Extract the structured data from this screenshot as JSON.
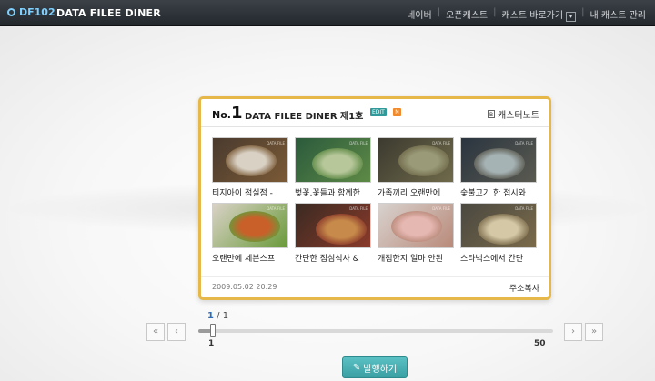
{
  "topbar": {
    "logo_text": "DF102",
    "app_title": "DATA FILEE DINER",
    "nav": [
      "네이버",
      "오픈캐스트",
      "캐스트 바로가기",
      "내 캐스트 관리"
    ]
  },
  "card": {
    "no_prefix": "No.",
    "no_number": "1",
    "title": "DATA FILEE DINER 제1호",
    "edit_badge": "EDIT",
    "n_badge": "N",
    "note_icon": "B",
    "note_link": "캐스터노트",
    "date": "2009.05.02 20:29",
    "copy_link": "주소복사",
    "items": [
      {
        "caption": "티지아이 점실점 -",
        "colors": [
          "#4a3a2e",
          "#d9d1c4",
          "#7a5a36"
        ],
        "stamp": "DATA FILE"
      },
      {
        "caption": "벚꽃,꽃들과 함께한",
        "colors": [
          "#2b5a3c",
          "#b7c79a",
          "#5e8a46"
        ],
        "stamp": "DATA FILE"
      },
      {
        "caption": "가족끼리 오랜만에",
        "colors": [
          "#3c3a30",
          "#9a9a78",
          "#6f6a4a"
        ],
        "stamp": "DATA FILE"
      },
      {
        "caption": "숯불고기 한 접시와",
        "colors": [
          "#2a3540",
          "#a6b3b5",
          "#5a5a50"
        ],
        "stamp": "DATA FILE"
      },
      {
        "caption": "오랜만에 세븐스프",
        "colors": [
          "#d9d2c6",
          "#c9602a",
          "#6a9a3a"
        ],
        "stamp": "DATA FILE"
      },
      {
        "caption": "간단한 점심식사 &",
        "colors": [
          "#3a2a22",
          "#c78a4a",
          "#8a3a2a"
        ],
        "stamp": "DATA FILE"
      },
      {
        "caption": "개점한지 얼마 안된",
        "colors": [
          "#d8d2ce",
          "#e6b8b2",
          "#b98a7a"
        ],
        "stamp": "DATA FILE"
      },
      {
        "caption": "스타벅스에서 간단",
        "colors": [
          "#4a4840",
          "#d4c8a6",
          "#7a6a4a"
        ],
        "stamp": "DATA FILE"
      }
    ]
  },
  "pager": {
    "first": "«",
    "prev": "‹",
    "next": "›",
    "last": "»",
    "current": "1",
    "separator": " / ",
    "total": "1",
    "slider_min": "1",
    "slider_max": "50",
    "slider_value": 1
  },
  "publish": {
    "icon": "✎",
    "label": "발행하기"
  }
}
